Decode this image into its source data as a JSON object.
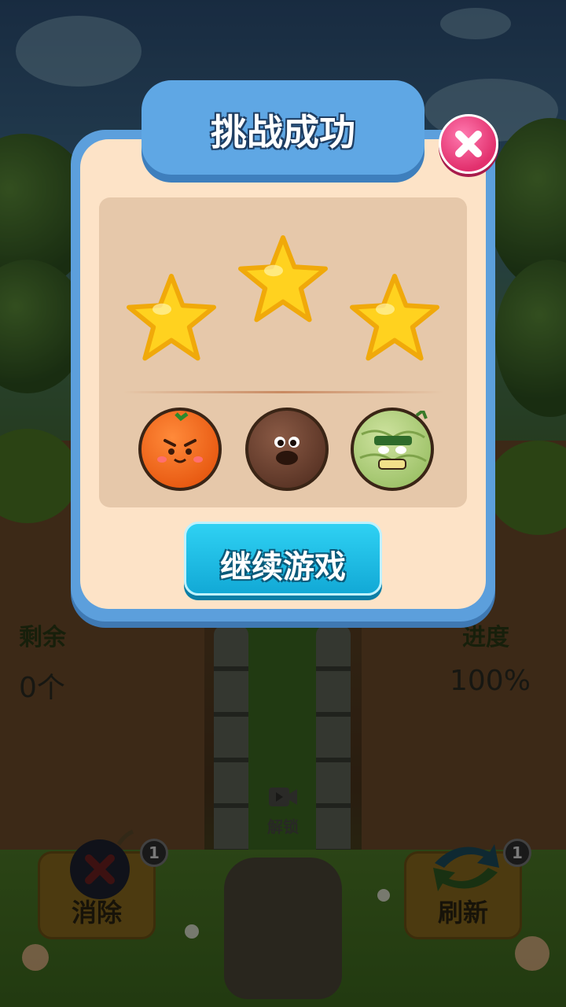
{
  "hud": {
    "remaining_label": "剩余",
    "remaining_value": "0个",
    "progress_label": "进度",
    "progress_value": "100%"
  },
  "tools": {
    "eliminate": {
      "label": "消除",
      "count": "1",
      "icon": "bomb-icon"
    },
    "refresh": {
      "label": "刷新",
      "count": "1",
      "icon": "refresh-arrows-icon"
    },
    "unlock": {
      "label": "解锁",
      "icon": "video-icon"
    }
  },
  "modal": {
    "title": "挑战成功",
    "stars_earned": 3,
    "stars_total": 3,
    "fruits": [
      "orange",
      "coconut",
      "melon"
    ],
    "continue_label": "继续游戏",
    "close_icon": "close-icon"
  },
  "colors": {
    "star": "#ffd21f",
    "continue_button": "#1ebde8",
    "close_button": "#f23d7d",
    "title_banner": "#5fa7e4"
  }
}
